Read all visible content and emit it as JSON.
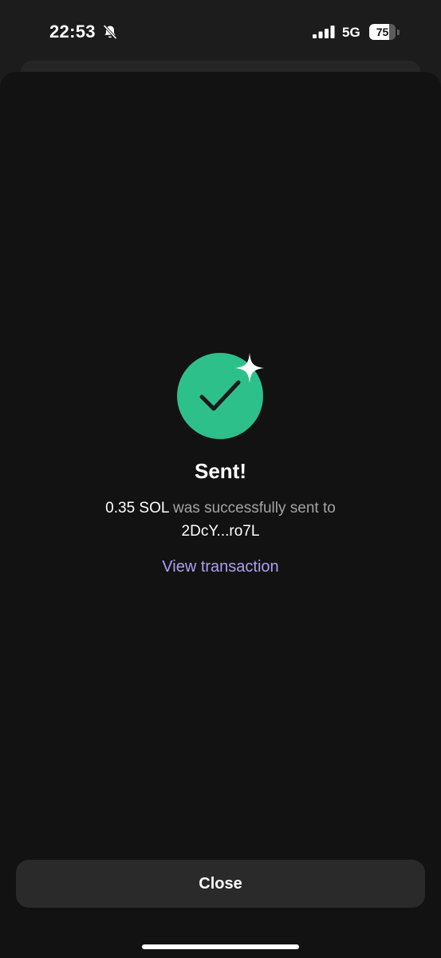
{
  "status_bar": {
    "time": "22:53",
    "network": "5G",
    "battery_percent": "75",
    "battery_level": 0.75,
    "icons": [
      "bell-slash-icon",
      "signal-icon",
      "battery-icon"
    ]
  },
  "success": {
    "icon": "check-circle-sparkle-icon",
    "title": "Sent!",
    "amount": "0.35 SOL",
    "message": " was successfully sent to",
    "recipient": "2DcY...ro7L",
    "view_transaction_label": "View transaction"
  },
  "footer": {
    "close_label": "Close"
  },
  "colors": {
    "background": "#121212",
    "success_green": "#2ec08b",
    "link_purple": "#ab9ff2",
    "button_bg": "#2a2a2a",
    "muted_text": "#a3a3a3"
  }
}
